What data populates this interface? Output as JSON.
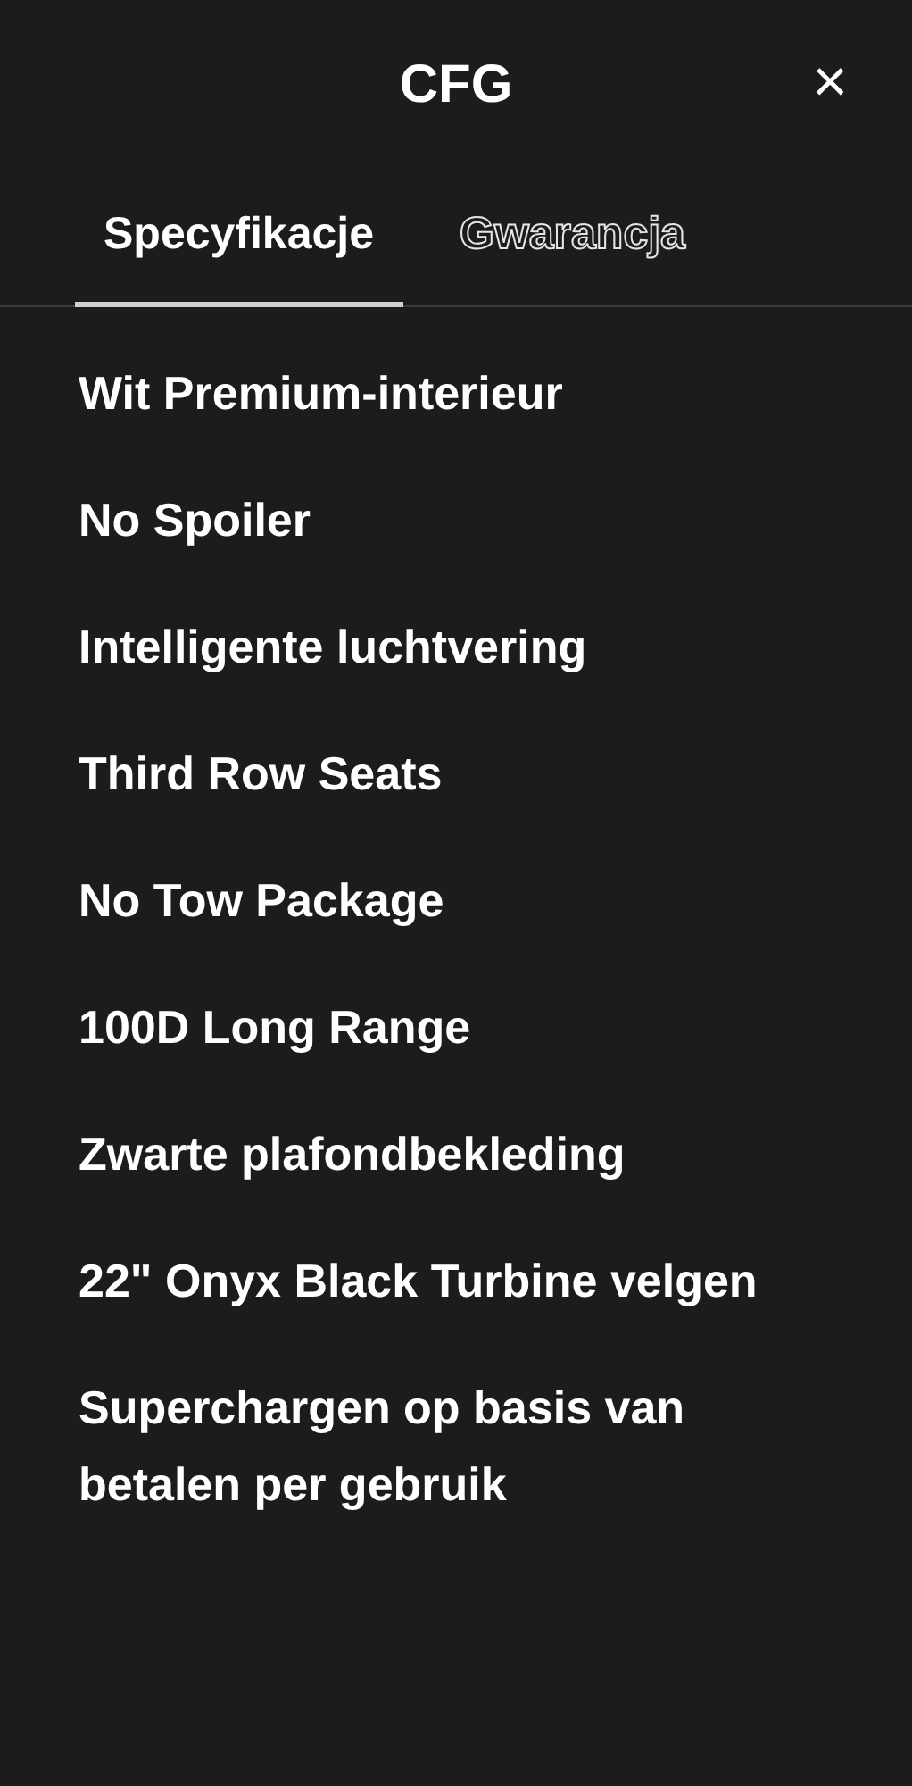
{
  "header": {
    "title": "CFG",
    "close": "×"
  },
  "tabs": [
    {
      "label": "Specyfikacje",
      "selected": true
    },
    {
      "label": "Gwarancja",
      "selected": false
    }
  ],
  "items": [
    "Wit Premium-interieur",
    "No Spoiler",
    "Intelligente luchtvering",
    "Third Row Seats",
    "No Tow Package",
    "100D Long Range",
    "Zwarte plafondbekleding",
    "22\" Onyx Black Turbine velgen",
    "Superchargen op basis van betalen per gebruik"
  ]
}
